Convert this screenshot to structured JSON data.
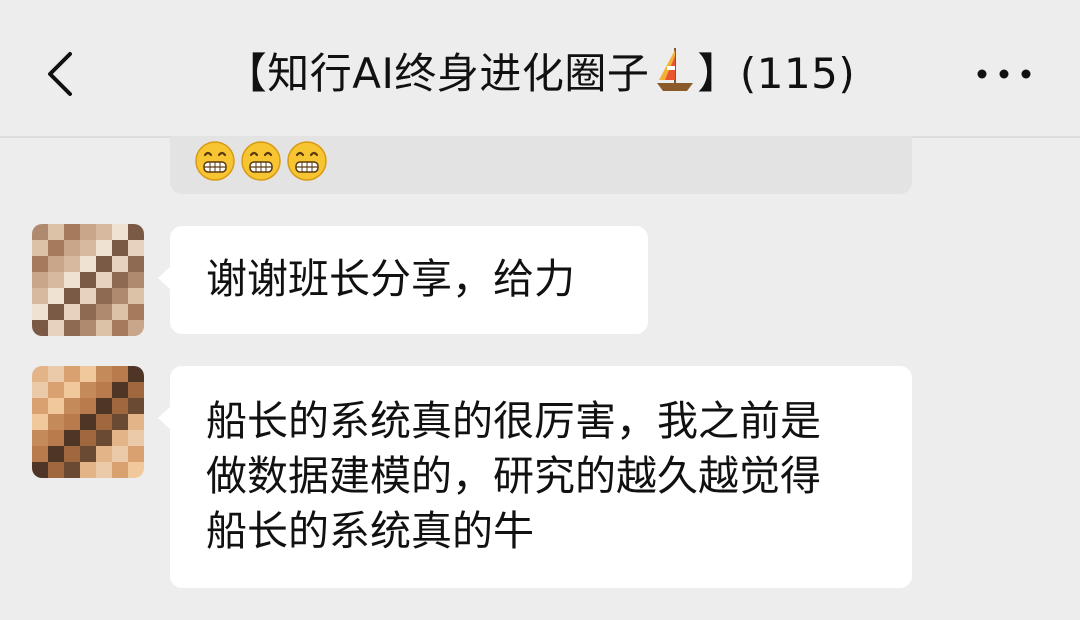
{
  "header": {
    "title": "【知行AI终身进化圈子",
    "title_suffix": "】(115)",
    "title_emoji": "sailboat-icon",
    "back_icon": "chevron-left-icon",
    "more_icon": "more-dots-icon"
  },
  "previous_message": {
    "emojis": [
      "grin-emoji",
      "grin-emoji",
      "grin-emoji"
    ]
  },
  "messages": [
    {
      "avatar": "pixelated-avatar-1",
      "text": "谢谢班长分享，给力"
    },
    {
      "avatar": "pixelated-avatar-2",
      "lines": [
        "船长的系统真的很厉害，我之前是",
        "做数据建模的，研究的越久越觉得",
        "船长的系统真的牛"
      ]
    }
  ],
  "colors": {
    "background": "#ededed",
    "bubble": "#ffffff",
    "text": "#111111"
  }
}
